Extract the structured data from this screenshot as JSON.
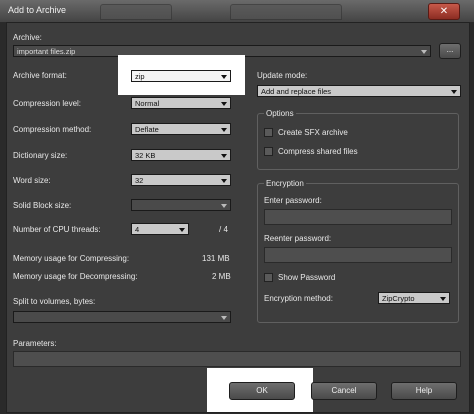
{
  "window": {
    "title": "Add to Archive",
    "close_glyph": "✕"
  },
  "archive": {
    "label": "Archive:",
    "path": "important files.zip",
    "browse_label": "..."
  },
  "left": {
    "format": {
      "label": "Archive format:",
      "value": "zip"
    },
    "compression_level": {
      "label": "Compression level:",
      "value": "Normal"
    },
    "compression_method": {
      "label": "Compression method:",
      "value": "Deflate"
    },
    "dictionary_size": {
      "label": "Dictionary size:",
      "value": "32 KB"
    },
    "word_size": {
      "label": "Word size:",
      "value": "32"
    },
    "solid_block": {
      "label": "Solid Block size:",
      "value": ""
    },
    "cpu_threads": {
      "label": "Number of CPU threads:",
      "value": "4",
      "max": "/ 4"
    },
    "mem_compress": {
      "label": "Memory usage for Compressing:",
      "value": "131 MB"
    },
    "mem_decompress": {
      "label": "Memory usage for Decompressing:",
      "value": "2 MB"
    },
    "split": {
      "label": "Split to volumes, bytes:",
      "value": ""
    },
    "parameters": {
      "label": "Parameters:",
      "value": ""
    }
  },
  "right": {
    "update_mode": {
      "label": "Update mode:",
      "value": "Add and replace files"
    },
    "options": {
      "title": "Options",
      "create_sfx": "Create SFX archive",
      "compress_shared": "Compress shared files"
    },
    "encryption": {
      "title": "Encryption",
      "enter_password": "Enter password:",
      "reenter_password": "Reenter password:",
      "show_password": "Show Password",
      "method_label": "Encryption method:",
      "method_value": "ZipCrypto"
    }
  },
  "buttons": {
    "ok": "OK",
    "cancel": "Cancel",
    "help": "Help"
  }
}
